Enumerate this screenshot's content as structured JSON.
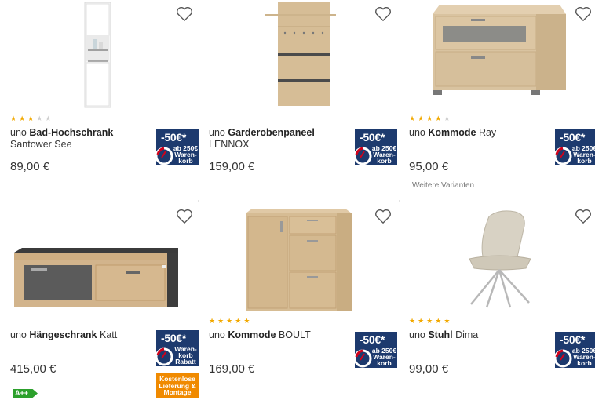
{
  "products": [
    {
      "brand": "uno",
      "name": "Bad-Hochschrank",
      "variant": "Santower See",
      "price": "89,00 €",
      "rating": 3,
      "badge": {
        "amount": "-50€*",
        "text": "ab 250€ Waren- korb"
      },
      "variants_link": "",
      "extra_badge": "",
      "energy_label": ""
    },
    {
      "brand": "uno",
      "name": "Garderobenpaneel",
      "variant": "LENNOX",
      "price": "159,00 €",
      "rating": 0,
      "badge": {
        "amount": "-50€*",
        "text": "ab 250€ Waren- korb"
      },
      "variants_link": "",
      "extra_badge": "",
      "energy_label": ""
    },
    {
      "brand": "uno",
      "name": "Kommode",
      "variant": "Ray",
      "price": "95,00 €",
      "rating": 4,
      "badge": {
        "amount": "-50€*",
        "text": "ab 250€ Waren- korb"
      },
      "variants_link": "Weitere Varianten",
      "extra_badge": "",
      "energy_label": ""
    },
    {
      "brand": "uno",
      "name": "Hängeschrank",
      "variant": "Katt",
      "price": "415,00 €",
      "rating": 0,
      "badge": {
        "amount": "-50€*",
        "text": "Waren- korb Rabatt"
      },
      "variants_link": "",
      "extra_badge": "Kostenlose Lieferung & Montage",
      "energy_label": "A++"
    },
    {
      "brand": "uno",
      "name": "Kommode",
      "variant": "BOULT",
      "price": "169,00 €",
      "rating": 5,
      "badge": {
        "amount": "-50€*",
        "text": "ab 250€ Waren- korb"
      },
      "variants_link": "",
      "extra_badge": "",
      "energy_label": ""
    },
    {
      "brand": "uno",
      "name": "Stuhl",
      "variant": "Dima",
      "price": "99,00 €",
      "rating": 5,
      "badge": {
        "amount": "-50€*",
        "text": "ab 250€ Waren- korb"
      },
      "variants_link": "",
      "extra_badge": "",
      "energy_label": ""
    }
  ],
  "icons": {
    "favorite": "heart-outline-icon",
    "rating": "star-icon"
  },
  "colors": {
    "badge_blue": "#1d3a6e",
    "star": "#f2a900",
    "orange": "#f08a00",
    "energy": "#2ca02c"
  }
}
